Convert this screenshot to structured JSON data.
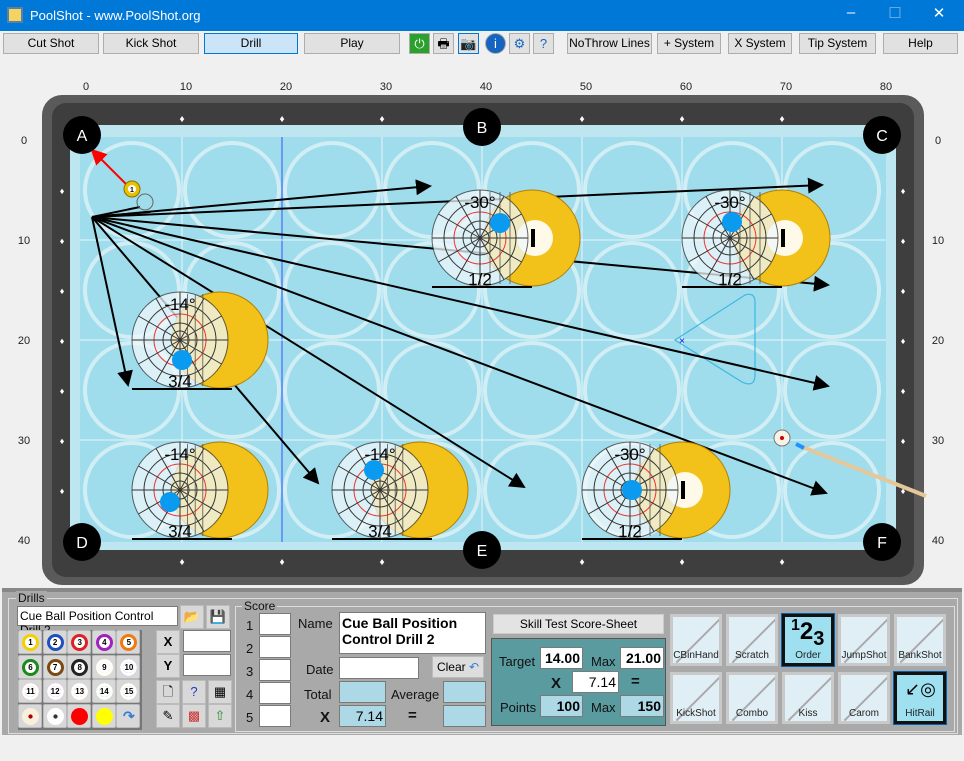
{
  "window": {
    "title": "PoolShot - www.PoolShot.org",
    "min": "–",
    "max": "☐",
    "close": "✕"
  },
  "toolbar": {
    "buttons": [
      "Cut Shot",
      "Kick Shot",
      "Drill",
      "Play"
    ],
    "selected": "Drill",
    "icons": [
      "power-icon",
      "print-icon",
      "camera-icon",
      "info-icon",
      "settings-icon",
      "help-doc-icon"
    ],
    "buttons2": [
      "NoThrow Lines",
      "+ System",
      "X System",
      "Tip System",
      "Help"
    ]
  },
  "table": {
    "x_ticks": [
      "0",
      "10",
      "20",
      "30",
      "40",
      "50",
      "60",
      "70",
      "80"
    ],
    "y_ticks": [
      "0",
      "10",
      "20",
      "30",
      "40"
    ],
    "pockets": [
      "A",
      "B",
      "C",
      "D",
      "E",
      "F"
    ],
    "object_ball": "1",
    "ghost_diagrams": [
      {
        "angle": "-30°",
        "fraction": "1/2"
      },
      {
        "angle": "-30°",
        "fraction": "1/2"
      },
      {
        "angle": "-14°",
        "fraction": "3/4"
      },
      {
        "angle": "-14°",
        "fraction": "3/4"
      },
      {
        "angle": "-14°",
        "fraction": "3/4"
      },
      {
        "angle": "-30°",
        "fraction": "1/2"
      }
    ],
    "colors": {
      "cloth": "#9fdcec",
      "rail": "#4a4a4a",
      "arrow": "#000000",
      "aim": "#ff0000",
      "cue_tip": "#1e90ff"
    }
  },
  "drills": {
    "legend": "Drills",
    "name": "Cue Ball Position Control Drill 2",
    "x_label": "X",
    "y_label": "Y",
    "x_value": "",
    "y_value": "",
    "balls": [
      "1",
      "2",
      "3",
      "4",
      "5",
      "6",
      "7",
      "8",
      "9",
      "10",
      "11",
      "12",
      "13",
      "14",
      "15"
    ]
  },
  "score": {
    "legend": "Score",
    "rows": [
      "1",
      "2",
      "3",
      "4",
      "5"
    ],
    "name_label": "Name",
    "name_value": "Cue Ball Position Control Drill 2",
    "date_label": "Date",
    "date_value": "",
    "clear": "Clear",
    "total_label": "Total",
    "average_label": "Average",
    "x": "X",
    "multiplier": "7.14",
    "eq": "="
  },
  "skill": {
    "title": "Skill Test Score-Sheet",
    "target_label": "Target",
    "target": "14.00",
    "max_label": "Max",
    "max": "21.00",
    "x": "X",
    "multiplier": "7.14",
    "eq": "=",
    "points_label": "Points",
    "points": "100",
    "points_max": "150"
  },
  "shots": [
    {
      "label": "CBinHand",
      "on": false
    },
    {
      "label": "Scratch",
      "on": false
    },
    {
      "label": "Order",
      "on": true
    },
    {
      "label": "JumpShot",
      "on": false
    },
    {
      "label": "BankShot",
      "on": false
    },
    {
      "label": "KickShot",
      "on": false
    },
    {
      "label": "Combo",
      "on": false
    },
    {
      "label": "Kiss",
      "on": false
    },
    {
      "label": "Carom",
      "on": false
    },
    {
      "label": "HitRail",
      "on": true
    }
  ]
}
